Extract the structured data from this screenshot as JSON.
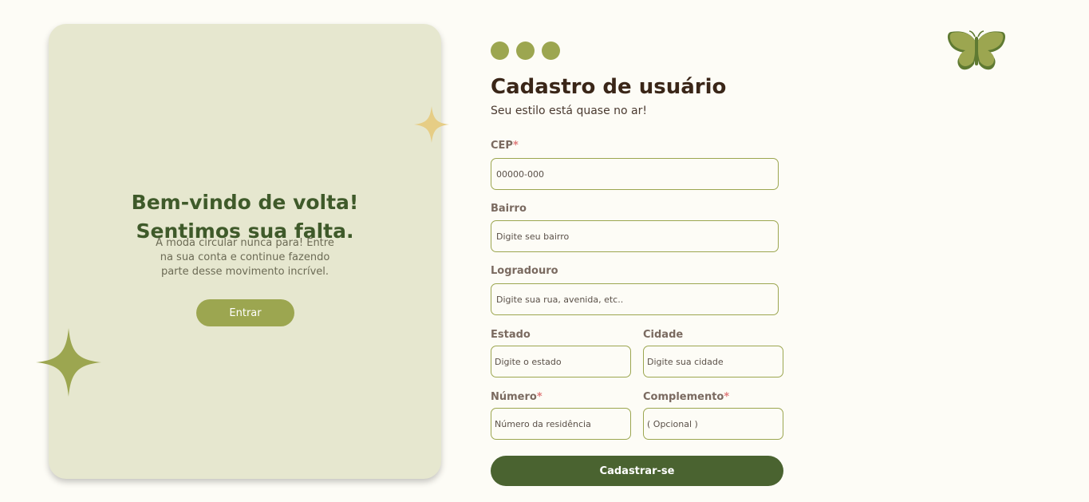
{
  "welcome": {
    "title_line1": "Bem-vindo de volta!",
    "title_line2": "Sentimos sua falta.",
    "text": "A moda circular nunca para! Entre na sua conta e continue fazendo parte desse movimento incrível.",
    "enter_label": "Entrar"
  },
  "form": {
    "title": "Cadastro de usuário",
    "subtitle": "Seu estilo está quase no ar!",
    "cep": {
      "label": "CEP",
      "required": "*",
      "placeholder": "00000-000"
    },
    "bairro": {
      "label": "Bairro",
      "placeholder": "Digite seu bairro"
    },
    "logradouro": {
      "label": "Logradouro",
      "placeholder": "Digite sua rua, avenida, etc.."
    },
    "estado": {
      "label": "Estado",
      "placeholder": "Digite o estado"
    },
    "cidade": {
      "label": "Cidade",
      "placeholder": "Digite sua cidade"
    },
    "numero": {
      "label": "Número",
      "required": "*",
      "placeholder": "Número da residência"
    },
    "complemento": {
      "label": "Complemento",
      "required": "*",
      "placeholder": "( Opcional )"
    },
    "submit_label": "Cadastrar-se"
  },
  "icons": {
    "step_dots": "step-dots",
    "butterfly": "butterfly-icon",
    "sparkle": "sparkle-icon"
  },
  "colors": {
    "accent": "#9ca650",
    "dark_green": "#4a6330",
    "card_bg": "#e6e7cf",
    "sparkle_gold": "#e6cd85"
  }
}
